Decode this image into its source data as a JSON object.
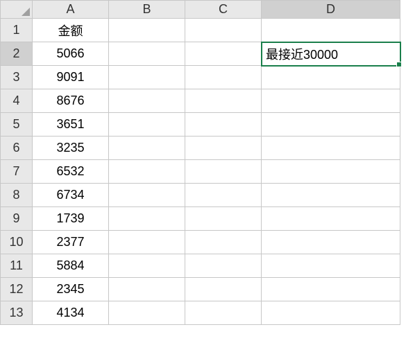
{
  "columns": [
    "A",
    "B",
    "C",
    "D"
  ],
  "row_headers": [
    "1",
    "2",
    "3",
    "4",
    "5",
    "6",
    "7",
    "8",
    "9",
    "10",
    "11",
    "12",
    "13"
  ],
  "active_cell": "D2",
  "active_col": "D",
  "active_row": "2",
  "cells": {
    "A1": "金额",
    "A2": "5066",
    "A3": "9091",
    "A4": "8676",
    "A5": "3651",
    "A6": "3235",
    "A7": "6532",
    "A8": "6734",
    "A9": "1739",
    "A10": "2377",
    "A11": "5884",
    "A12": "2345",
    "A13": "4134",
    "D2": "最接近30000"
  },
  "chart_data": {
    "type": "table",
    "title": "金额",
    "categories": [
      "A2",
      "A3",
      "A4",
      "A5",
      "A6",
      "A7",
      "A8",
      "A9",
      "A10",
      "A11",
      "A12",
      "A13"
    ],
    "values": [
      5066,
      9091,
      8676,
      3651,
      3235,
      6532,
      6734,
      1739,
      2377,
      5884,
      2345,
      4134
    ],
    "note": "最接近30000"
  }
}
